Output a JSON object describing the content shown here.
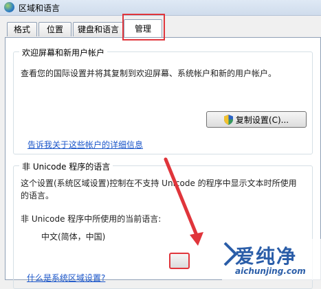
{
  "window": {
    "title": "区域和语言"
  },
  "tabs": [
    {
      "label": "格式"
    },
    {
      "label": "位置"
    },
    {
      "label": "键盘和语言"
    },
    {
      "label": "管理",
      "active": true
    }
  ],
  "welcome_group": {
    "title": "欢迎屏幕和新用户帐户",
    "description": "查看您的国际设置并将其复制到欢迎屏幕、系统帐户和新的用户帐户。",
    "copy_button": "复制设置(C)...",
    "link": "告诉我关于这些帐户的详细信息"
  },
  "unicode_group": {
    "title": "非 Unicode 程序的语言",
    "description_line1": "这个设置(系统区域设置)控制在不支持 Unicode 的程序中显示文本时所使用",
    "description_line2": "的语言。",
    "current_label": "非 Unicode 程序中所使用的当前语言:",
    "current_value": "中文(简体，中国)"
  },
  "bottom_link": "什么是系统区域设置?",
  "watermark": {
    "text": "爱纯净",
    "url": "aichunjing.com"
  },
  "colors": {
    "highlight_red": "#e0353b",
    "link_blue": "#1a55c9",
    "watermark_blue": "#2a5da8"
  },
  "icons": [
    "globe-icon",
    "shield-icon",
    "arrow-annotation"
  ]
}
